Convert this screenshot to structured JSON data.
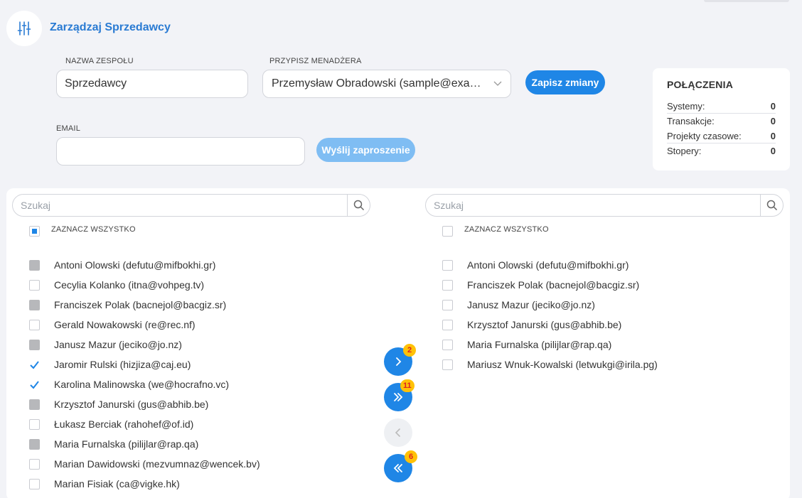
{
  "header": {
    "title": "Zarządzaj Sprzedawcy",
    "icon": "sliders-icon"
  },
  "form": {
    "team_name_label": "NAZWA ZESPOŁU",
    "team_name_value": "Sprzedawcy",
    "manager_label": "PRZYPISZ MENADŻERA",
    "manager_value": "Przemysław Obradowski (sample@example.com)",
    "save_label": "Zapisz zmiany",
    "email_label": "EMAIL",
    "email_value": "",
    "invite_label": "Wyślij zaproszenie"
  },
  "connections": {
    "title": "POŁĄCZENIA",
    "rows": [
      {
        "label": "Systemy:",
        "value": "0"
      },
      {
        "label": "Transakcje:",
        "value": "0"
      },
      {
        "label": "Projekty czasowe:",
        "value": "0"
      },
      {
        "label": "Stopery:",
        "value": "0"
      }
    ]
  },
  "left_list": {
    "search_placeholder": "Szukaj",
    "select_all_label": "ZAZNACZ WSZYSTKO",
    "select_all_state": "partial",
    "items": [
      {
        "label": "Antoni Olowski (defutu@mifbokhi.gr)",
        "state": "disabled"
      },
      {
        "label": "Cecylia Kolanko (itna@vohpeg.tv)",
        "state": "unchecked"
      },
      {
        "label": "Franciszek Polak (bacnejol@bacgiz.sr)",
        "state": "disabled"
      },
      {
        "label": "Gerald Nowakowski (re@rec.nf)",
        "state": "unchecked"
      },
      {
        "label": "Janusz Mazur (jeciko@jo.nz)",
        "state": "disabled"
      },
      {
        "label": "Jaromir Rulski (hizjiza@caj.eu)",
        "state": "checked"
      },
      {
        "label": "Karolina Malinowska (we@hocrafno.vc)",
        "state": "checked"
      },
      {
        "label": "Krzysztof Janurski (gus@abhib.be)",
        "state": "disabled"
      },
      {
        "label": "Łukasz Berciak (rahohef@of.id)",
        "state": "unchecked"
      },
      {
        "label": "Maria Furnalska (pilijlar@rap.qa)",
        "state": "disabled"
      },
      {
        "label": "Marian Dawidowski (mezvumnaz@wencek.bv)",
        "state": "unchecked"
      },
      {
        "label": "Marian Fisiak (ca@vigke.hk)",
        "state": "unchecked"
      }
    ]
  },
  "right_list": {
    "search_placeholder": "Szukaj",
    "select_all_label": "ZAZNACZ WSZYSTKO",
    "select_all_state": "unchecked",
    "items": [
      {
        "label": "Antoni Olowski (defutu@mifbokhi.gr)",
        "state": "unchecked"
      },
      {
        "label": "Franciszek Polak (bacnejol@bacgiz.sr)",
        "state": "unchecked"
      },
      {
        "label": "Janusz Mazur (jeciko@jo.nz)",
        "state": "unchecked"
      },
      {
        "label": "Krzysztof Janurski (gus@abhib.be)",
        "state": "unchecked"
      },
      {
        "label": "Maria Furnalska (pilijlar@rap.qa)",
        "state": "unchecked"
      },
      {
        "label": "Mariusz Wnuk-Kowalski (letwukgi@irila.pg)",
        "state": "unchecked"
      }
    ]
  },
  "transfer": {
    "move_selected_right": {
      "badge": "2",
      "icon": "chevron-right-icon",
      "enabled": true
    },
    "move_all_right": {
      "badge": "11",
      "icon": "double-chevron-right-icon",
      "enabled": true
    },
    "move_selected_left": {
      "badge": "",
      "icon": "chevron-left-icon",
      "enabled": false
    },
    "move_all_left": {
      "badge": "6",
      "icon": "double-chevron-left-icon",
      "enabled": true
    }
  },
  "colors": {
    "accent": "#1f86e6",
    "accent_disabled": "#7fbdf3",
    "title": "#2a7bd3",
    "badge": "#ffc107",
    "badge_text": "#dd2222",
    "background": "#f2f3f7"
  }
}
